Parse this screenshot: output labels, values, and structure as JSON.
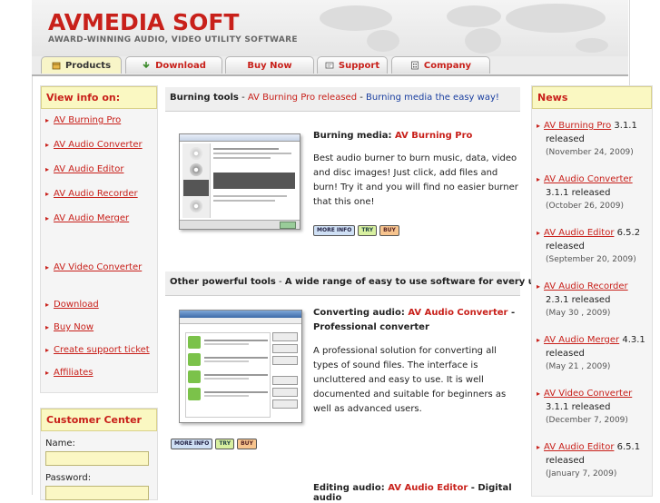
{
  "brand": {
    "logo": "AVMEDIA SOFT",
    "tagline": "AWARD-WINNING AUDIO, VIDEO UTILITY SOFTWARE"
  },
  "nav": {
    "tabs": [
      {
        "label": "Products",
        "icon": "box-icon"
      },
      {
        "label": "Download",
        "icon": "download-icon"
      },
      {
        "label": "Buy Now",
        "icon": ""
      },
      {
        "label": "Support",
        "icon": "support-icon"
      },
      {
        "label": "Company",
        "icon": "building-icon"
      }
    ]
  },
  "sidebar": {
    "title": "View info on:",
    "links": [
      "AV Burning Pro",
      "AV Audio Converter",
      "AV Audio Editor",
      "AV Audio Recorder",
      "AV Audio Merger",
      "",
      "AV Video Converter",
      "",
      "Download",
      "Buy Now",
      "Create support ticket",
      "Affiliates"
    ]
  },
  "customer_center": {
    "title": "Customer Center",
    "name_label": "Name:",
    "password_label": "Password:"
  },
  "main": {
    "burning": {
      "head_bold": "Burning tools",
      "head_sep": " - ",
      "head_red": "AV Burning Pro released",
      "head_sep2": " - ",
      "head_blue": "Burning media the easy way!",
      "product_label": "Burning media: ",
      "product_name": "AV Burning Pro",
      "desc": "Best audio burner to burn music, data, video and disc images! Just click, add files and burn! Try it and you will find no easier burner that this one!"
    },
    "other": {
      "head_bold": "Other powerful tools",
      "head_sep": " - ",
      "head_red": "A wide range of easy to use software for every user!",
      "converter_label": "Converting audio: ",
      "converter_name": "AV Audio Converter",
      "converter_suffix": " - Professional converter",
      "converter_desc": "A professional solution for converting all types of sound files. The interface is uncluttered and easy to use. It is well documented and suitable for beginners as well as advanced users.",
      "editor_label": "Editing audio: ",
      "editor_name": "AV Audio Editor",
      "editor_suffix": " - Digital audio"
    },
    "buttons": {
      "more": "MORE INFO",
      "try": "TRY",
      "buy": "BUY"
    }
  },
  "news": {
    "title": "News",
    "items": [
      {
        "name": "AV Burning Pro",
        "version": " 3.1.1",
        "rest": "released",
        "date": "(November 24, 2009)"
      },
      {
        "name": "AV Audio Converter",
        "version": "",
        "rest": "3.1.1 released",
        "date": "(October 26, 2009)"
      },
      {
        "name": "AV Audio Editor",
        "version": " 6.5.2",
        "rest": "released",
        "date": "(September 20, 2009)"
      },
      {
        "name": "AV Audio Recorder",
        "version": "",
        "rest": "2.3.1 released",
        "date": "(May 30 , 2009)"
      },
      {
        "name": "AV Audio Merger",
        "version": " 4.3.1",
        "rest": "released",
        "date": "(May 21 , 2009)"
      },
      {
        "name": "AV Video Converter",
        "version": "",
        "rest": "3.1.1 released",
        "date": "(December 7, 2009)"
      },
      {
        "name": "AV Audio Editor",
        "version": " 6.5.1",
        "rest": "released",
        "date": "(January 7, 2009)"
      }
    ]
  },
  "colors": {
    "accent": "#c8201a",
    "link_blue": "#1a3fa0",
    "box_yellow": "#faf8c2"
  }
}
